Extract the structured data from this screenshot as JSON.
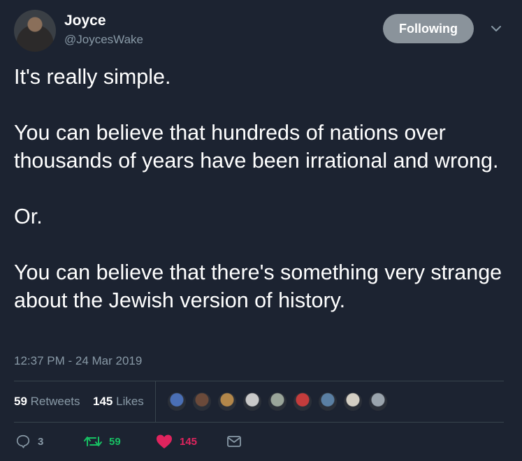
{
  "author": {
    "name": "Joyce",
    "handle": "@JoycesWake"
  },
  "follow_button": {
    "label": "Following"
  },
  "tweet": {
    "paragraphs": [
      "It's really simple.",
      "You can believe that hundreds of nations over thousands of years have been irrational and wrong.",
      "Or.",
      "You can believe that there's something very strange about the Jewish version of history."
    ],
    "timestamp": "12:37 PM - 24 Mar 2019"
  },
  "stats": {
    "retweets_count": "59",
    "retweets_label": "Retweets",
    "likes_count": "145",
    "likes_label": "Likes"
  },
  "likers": [
    {
      "color": "#4a6fb5"
    },
    {
      "color": "#6b4a3a"
    },
    {
      "color": "#b3874a"
    },
    {
      "color": "#c9c9c9"
    },
    {
      "color": "#9aa59a"
    },
    {
      "color": "#c43c3c"
    },
    {
      "color": "#5a7fa3"
    },
    {
      "color": "#d4cfc4"
    },
    {
      "color": "#9aa4ad"
    }
  ],
  "actions": {
    "reply_count": "3",
    "retweet_count": "59",
    "like_count": "145"
  },
  "colors": {
    "background": "#1c2331",
    "muted": "#8899a6",
    "retweet_green": "#17bf63",
    "like_pink": "#e0245e",
    "follow_bg": "#8a939b"
  }
}
